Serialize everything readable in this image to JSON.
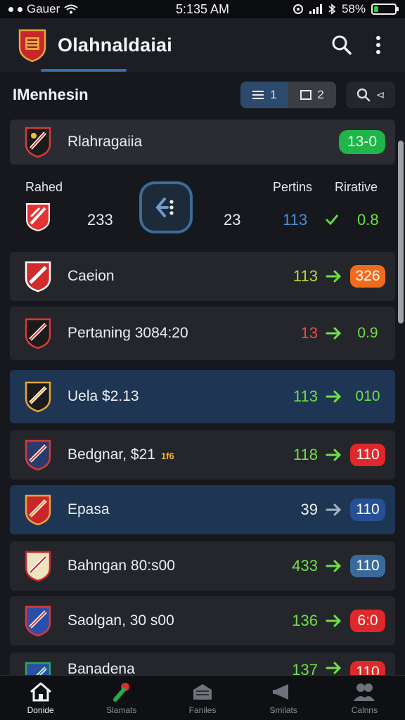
{
  "status": {
    "carrier": "Gauer",
    "time": "5:135 AM",
    "battery": "58%"
  },
  "app": {
    "title": "Olahnaldaiai"
  },
  "section": {
    "title": "IMenhesin",
    "toggle_list": "1",
    "toggle_grid": "2",
    "search_hint": "⊲"
  },
  "featured": {
    "name": "Rlahragaiia",
    "score": "13-0"
  },
  "match": {
    "home_label": "Rahed",
    "col_label_1": "Pertins",
    "col_label_2": "Rirative",
    "home_score": "233",
    "away_score": "23",
    "points": "113",
    "relative": "0.8"
  },
  "rows": [
    {
      "name": "Caeion",
      "sub": "",
      "value": "113",
      "value_color": "#b7d94a",
      "badge": "326",
      "badge_bg": "#f26b1d",
      "badge_fg": "#ffffff",
      "arrow_color": "#6fe049",
      "style": "dark"
    },
    {
      "name": "Pertaning 3084:20",
      "sub": "",
      "value": "13",
      "value_color": "#f04848",
      "badge": "0.9",
      "badge_bg": "transparent",
      "badge_fg": "#6fe049",
      "arrow_color": "#6fe049",
      "style": "dark"
    },
    {
      "name": "Uela $2.13",
      "sub": "",
      "value": "113",
      "value_color": "#6fe049",
      "badge": "010",
      "badge_bg": "transparent",
      "badge_fg": "#6fe049",
      "arrow_color": "#6fe049",
      "style": "blue"
    },
    {
      "name": "Bedgnar, $21",
      "sub": "1f6",
      "value": "118",
      "value_color": "#6fe049",
      "badge": "110",
      "badge_bg": "#e0282a",
      "badge_fg": "#ffffff",
      "arrow_color": "#6fe049",
      "style": "dark"
    },
    {
      "name": "Epasa",
      "sub": "",
      "value": "39",
      "value_color": "#eef0f3",
      "badge": "110",
      "badge_bg": "#264f96",
      "badge_fg": "#ffffff",
      "arrow_color": "#a8b4c4",
      "style": "blue"
    },
    {
      "name": "Bahngan 80:s00",
      "sub": "",
      "value": "433",
      "value_color": "#6fe049",
      "badge": "110",
      "badge_bg": "#3a6a9c",
      "badge_fg": "#ffffff",
      "arrow_color": "#6fe049",
      "style": "dark"
    },
    {
      "name": "Saolgan, 30 s00",
      "sub": "",
      "value": "136",
      "value_color": "#6fe049",
      "badge": "6:0",
      "badge_bg": "#e0282a",
      "badge_fg": "#ffffff",
      "arrow_color": "#6fe049",
      "style": "dark"
    },
    {
      "name": "Banadena",
      "sub": "",
      "value": "137",
      "value_color": "#6fe049",
      "badge": "110",
      "badge_bg": "#e0282a",
      "badge_fg": "#ffffff",
      "arrow_color": "#6fe049",
      "style": "dark"
    }
  ],
  "nav": [
    {
      "label": "Donide",
      "icon": "home-icon",
      "active": true
    },
    {
      "label": "Slamats",
      "icon": "whistle-icon",
      "active": false
    },
    {
      "label": "Faniles",
      "icon": "stadium-icon",
      "active": false
    },
    {
      "label": "Smilats",
      "icon": "megaphone-icon",
      "active": false
    },
    {
      "label": "Calnns",
      "icon": "users-icon",
      "active": false
    }
  ]
}
